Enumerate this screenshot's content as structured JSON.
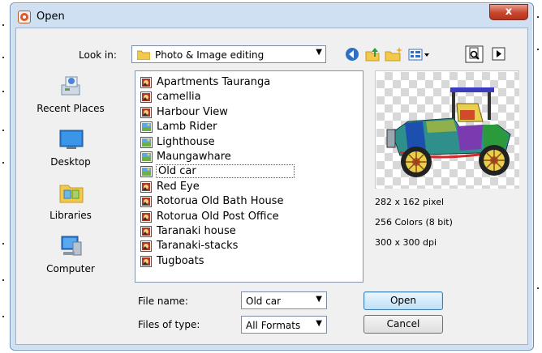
{
  "window": {
    "title": "Open",
    "close_glyph": "x"
  },
  "look_in": {
    "label": "Look in:",
    "value": "Photo & Image editing"
  },
  "toolbar": {
    "icons": [
      "back-icon",
      "up-folder-icon",
      "new-folder-icon",
      "views-menu-icon",
      "preview-toggle-icon",
      "more-arrow-icon"
    ]
  },
  "places": [
    {
      "label": "Recent Places",
      "icon": "recent-places-icon"
    },
    {
      "label": "Desktop",
      "icon": "desktop-icon"
    },
    {
      "label": "Libraries",
      "icon": "libraries-icon"
    },
    {
      "label": "Computer",
      "icon": "computer-icon"
    }
  ],
  "files": [
    {
      "name": "Apartments Tauranga",
      "icon": "image-file-icon",
      "selected": false
    },
    {
      "name": "camellia",
      "icon": "image-file-icon",
      "selected": false
    },
    {
      "name": "Harbour View",
      "icon": "image-file-icon",
      "selected": false
    },
    {
      "name": "Lamb Rider",
      "icon": "picture-file-icon",
      "selected": false
    },
    {
      "name": "Lighthouse",
      "icon": "picture-file-icon",
      "selected": false
    },
    {
      "name": "Maungawhare",
      "icon": "picture-file-icon",
      "selected": false
    },
    {
      "name": "Old car",
      "icon": "picture-file-icon",
      "selected": true
    },
    {
      "name": "Red Eye",
      "icon": "image-file-icon",
      "selected": false
    },
    {
      "name": "Rotorua Old Bath House",
      "icon": "image-file-icon",
      "selected": false
    },
    {
      "name": "Rotorua Old Post Office",
      "icon": "image-file-icon",
      "selected": false
    },
    {
      "name": "Taranaki house",
      "icon": "image-file-icon",
      "selected": false
    },
    {
      "name": "Taranaki-stacks",
      "icon": "image-file-icon",
      "selected": false
    },
    {
      "name": "Tugboats",
      "icon": "image-file-icon",
      "selected": false
    }
  ],
  "preview_info": {
    "dimensions": "282 x 162 pixel",
    "colors": "256 Colors (8 bit)",
    "dpi": "300 x 300 dpi"
  },
  "file_name": {
    "label": "File name:",
    "value": "Old car"
  },
  "file_type": {
    "label": "Files of type:",
    "value": "All Formats"
  },
  "buttons": {
    "open": "Open",
    "cancel": "Cancel"
  },
  "colors": {
    "frame": "#cfe0f3",
    "close": "#c8452d",
    "selection_border": "#555555",
    "default_button": "#3c7fb1"
  }
}
